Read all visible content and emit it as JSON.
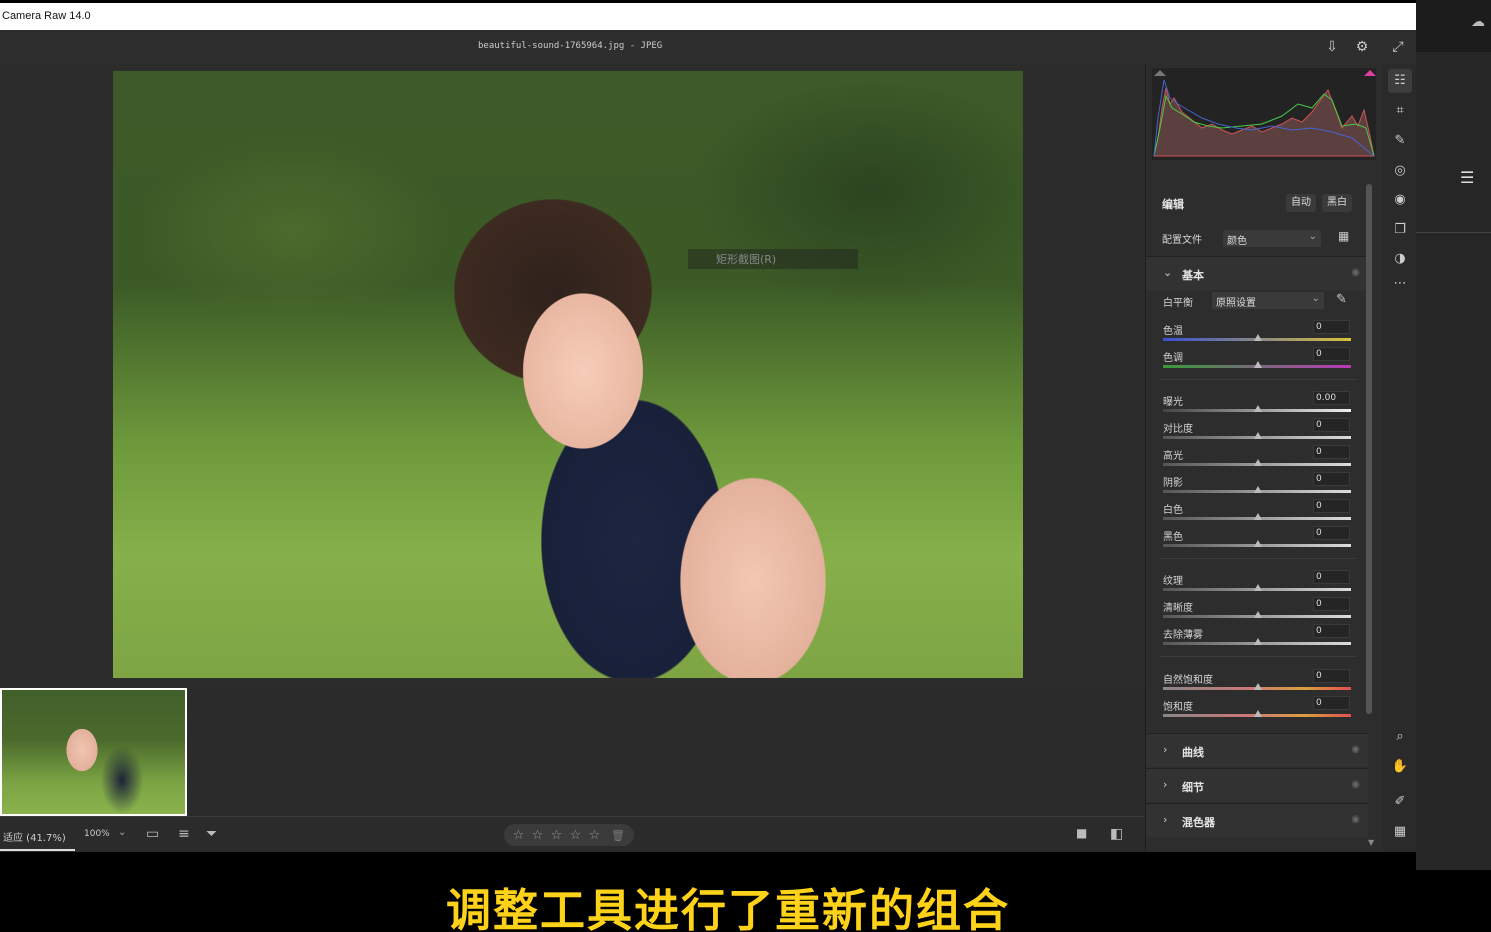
{
  "window": {
    "title": "Camera Raw 14.0"
  },
  "header": {
    "filename": "beautiful-sound-1765964.jpg  -  JPEG"
  },
  "photo": {
    "overlay_hint": "矩形截图(R)"
  },
  "panel": {
    "edit_label": "编辑",
    "auto_label": "自动",
    "bw_label": "黑白",
    "profile_label": "配置文件",
    "profile_value": "颜色",
    "basic_section": "基本",
    "wb_label": "白平衡",
    "wb_value": "原照设置",
    "sliders": [
      {
        "label": "色温",
        "value": "0"
      },
      {
        "label": "色调",
        "value": "0"
      },
      {
        "label": "曝光",
        "value": "0.00"
      },
      {
        "label": "对比度",
        "value": "0"
      },
      {
        "label": "高光",
        "value": "0"
      },
      {
        "label": "阴影",
        "value": "0"
      },
      {
        "label": "白色",
        "value": "0"
      },
      {
        "label": "黑色",
        "value": "0"
      },
      {
        "label": "纹理",
        "value": "0"
      },
      {
        "label": "清晰度",
        "value": "0"
      },
      {
        "label": "去除薄雾",
        "value": "0"
      },
      {
        "label": "自然饱和度",
        "value": "0"
      },
      {
        "label": "饱和度",
        "value": "0"
      }
    ],
    "sections_collapsed": [
      "曲线",
      "细节",
      "混色器"
    ]
  },
  "bottombar": {
    "zoom_fit": "适应 (41.7%)",
    "zoom_100": "100%"
  },
  "subtitle": "调整工具进行了重新的组合",
  "colors": {
    "subtitle": "#ffd21a",
    "panel_bg": "#2d2d2d",
    "temp_track": [
      "#3a4fd0",
      "#d8c23a"
    ],
    "tint_track": [
      "#3a9a3a",
      "#b83ab8"
    ]
  },
  "icons": [
    "save-icon",
    "gear-icon",
    "fullscreen-icon",
    "edit-sliders-icon",
    "crop-icon",
    "healing-icon",
    "mask-icon",
    "redeye-icon",
    "snapshot-icon",
    "presets-icon",
    "more-icon",
    "zoom-icon",
    "hand-icon",
    "color-sampler-icon",
    "grid-icon"
  ]
}
